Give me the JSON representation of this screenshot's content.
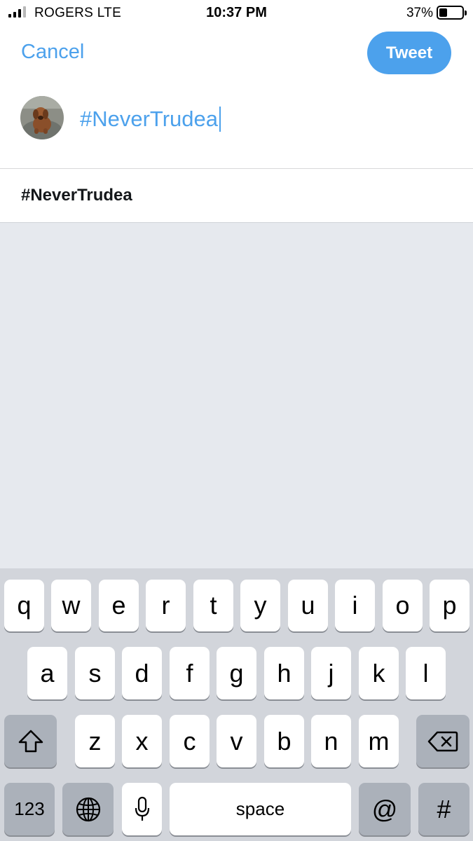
{
  "status_bar": {
    "carrier": "ROGERS  LTE",
    "time": "10:37 PM",
    "battery": "37%",
    "battery_level": 0.37
  },
  "header": {
    "cancel_label": "Cancel",
    "tweet_label": "Tweet"
  },
  "compose": {
    "text": "#NeverTrudea",
    "avatar_icon": "dog-avatar"
  },
  "suggestions": [
    {
      "label": "#NeverTrudea"
    }
  ],
  "keyboard": {
    "row1": [
      "q",
      "w",
      "e",
      "r",
      "t",
      "y",
      "u",
      "i",
      "o",
      "p"
    ],
    "row2": [
      "a",
      "s",
      "d",
      "f",
      "g",
      "h",
      "j",
      "k",
      "l"
    ],
    "row3": [
      "z",
      "x",
      "c",
      "v",
      "b",
      "n",
      "m"
    ],
    "numbers_label": "123",
    "space_label": "space",
    "at_label": "@",
    "hash_label": "#",
    "shift_icon": "shift-icon",
    "delete_icon": "backspace-icon",
    "globe_icon": "globe-icon",
    "mic_icon": "microphone-icon"
  },
  "colors": {
    "accent": "#4ca1ec",
    "keyboard_bg": "#d2d5db",
    "empty_area": "#e6e9ee"
  }
}
